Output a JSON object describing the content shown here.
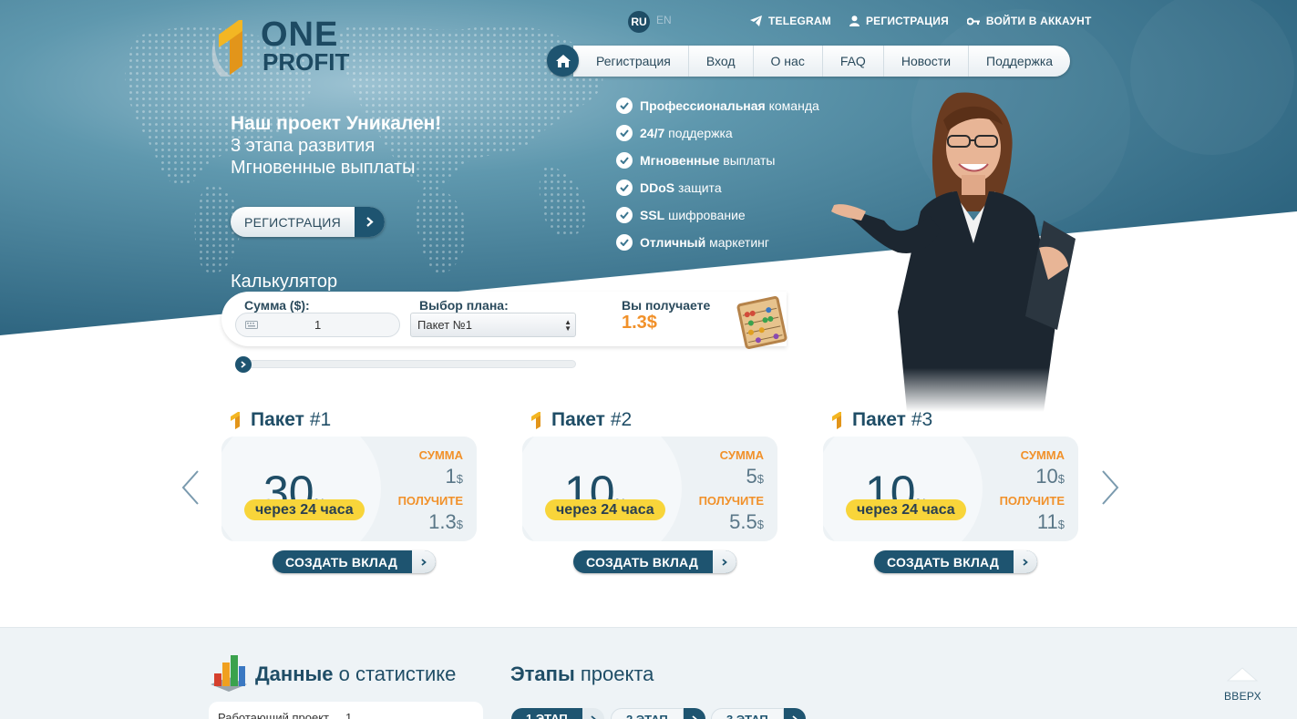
{
  "brand": {
    "line1": "ONE",
    "line2": "PROFIT"
  },
  "lang": {
    "active": "RU",
    "other": "EN"
  },
  "top_links": [
    {
      "label": "TELEGRAM",
      "icon": "telegram-icon"
    },
    {
      "label": "РЕГИСТРАЦИЯ",
      "icon": "user-icon"
    },
    {
      "label": "ВОЙТИ В АККАУНТ",
      "icon": "key-icon"
    }
  ],
  "nav": {
    "home_icon": "home-icon",
    "items": [
      "Регистрация",
      "Вход",
      "О нас",
      "FAQ",
      "Новости",
      "Поддержка"
    ]
  },
  "hero": {
    "title": "Наш проект Уникален!",
    "line2": "3 этапа развития",
    "line3": "Мгновенные выплаты",
    "register_label": "РЕГИСТРАЦИЯ"
  },
  "features": [
    {
      "bold": "Профессиональная",
      "rest": " команда"
    },
    {
      "bold": "24/7",
      "rest": " поддержка"
    },
    {
      "bold": "Мгновенные",
      "rest": " выплаты"
    },
    {
      "bold": "DDoS",
      "rest": " защита"
    },
    {
      "bold": "SSL",
      "rest": " шифрование"
    },
    {
      "bold": "Отличный",
      "rest": " маркетинг"
    }
  ],
  "calculator": {
    "title": "Калькулятор",
    "amount_label": "Сумма ($):",
    "amount_value": "1",
    "plan_label": "Выбор плана:",
    "plan_value": "Пакет №1",
    "result_label": "Вы получаете",
    "result_value": "1.3$",
    "slider_level": 0
  },
  "packages": [
    {
      "title_bold": "Пакет",
      "title_num": " #1",
      "percent": "30",
      "percent_unit": "%",
      "period": "через 24 часа",
      "sum_label": "СУММА",
      "sum_value": "1",
      "get_label": "ПОЛУЧИТЕ",
      "get_value": "1.3",
      "currency": "$",
      "button": "СОЗДАТЬ ВКЛАД"
    },
    {
      "title_bold": "Пакет",
      "title_num": " #2",
      "percent": "10",
      "percent_unit": "%",
      "period": "через 24 часа",
      "sum_label": "СУММА",
      "sum_value": "5",
      "get_label": "ПОЛУЧИТЕ",
      "get_value": "5.5",
      "currency": "$",
      "button": "СОЗДАТЬ ВКЛАД"
    },
    {
      "title_bold": "Пакет",
      "title_num": " #3",
      "percent": "10",
      "percent_unit": "%",
      "period": "через 24 часа",
      "sum_label": "СУММА",
      "sum_value": "10",
      "get_label": "ПОЛУЧИТЕ",
      "get_value": "11",
      "currency": "$",
      "button": "СОЗДАТЬ ВКЛАД"
    }
  ],
  "bottom": {
    "stats_bold": "Данные",
    "stats_rest": " о статистике",
    "stats_first_row": "Работающий проект ... 1",
    "stages_bold": "Этапы",
    "stages_rest": " проекта",
    "stages": [
      "1 ЭТАП",
      "2 ЭТАП",
      "3 ЭТАП"
    ],
    "up_label": "ВВЕРХ"
  },
  "colors": {
    "primary": "#1e5470",
    "accent": "#f1912a",
    "highlight": "#f8d53a",
    "hero": "#3d7a93"
  }
}
